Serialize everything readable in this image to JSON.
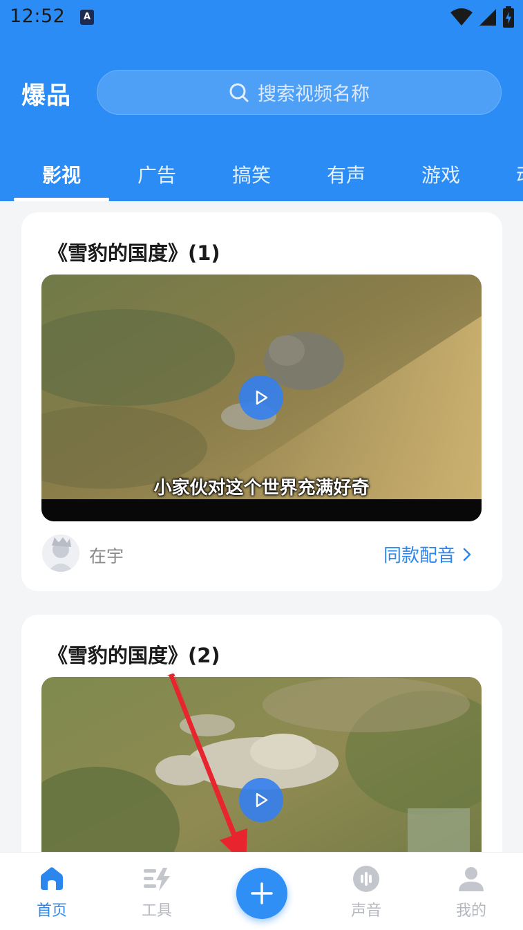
{
  "status_bar": {
    "time": "12:52",
    "notification_badge": "A"
  },
  "header": {
    "brand": "爆品",
    "search_placeholder": "搜索视频名称"
  },
  "tabs": [
    {
      "label": "影视",
      "active": true
    },
    {
      "label": "广告",
      "active": false
    },
    {
      "label": "搞笑",
      "active": false
    },
    {
      "label": "有声",
      "active": false
    },
    {
      "label": "游戏",
      "active": false
    },
    {
      "label": "动",
      "active": false
    }
  ],
  "cards": [
    {
      "title": "《雪豹的国度》(1)",
      "subtitle": "小家伙对这个世界充满好奇",
      "author": "在宇",
      "action": "同款配音"
    },
    {
      "title": "《雪豹的国度》(2)"
    }
  ],
  "bottom_nav": {
    "items": [
      {
        "label": "首页",
        "icon": "home-icon",
        "active": true
      },
      {
        "label": "工具",
        "icon": "tools-icon",
        "active": false
      },
      {
        "label": "声音",
        "icon": "sound-icon",
        "active": false
      },
      {
        "label": "我的",
        "icon": "profile-icon",
        "active": false
      }
    ],
    "fab_icon": "plus-icon"
  },
  "colors": {
    "primary": "#2b8cf5",
    "link": "#2b86ee",
    "annotation_arrow": "#e8242e"
  }
}
